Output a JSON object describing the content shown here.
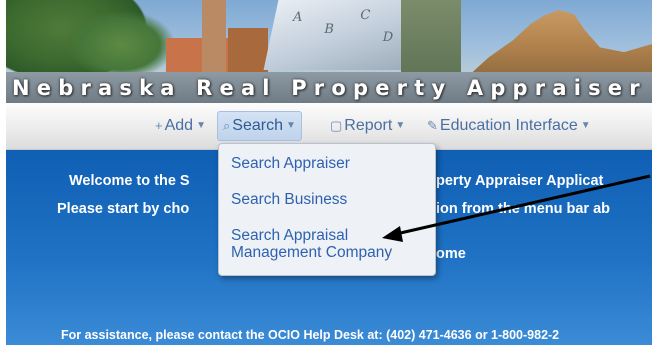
{
  "banner": {
    "title": "Nebraska Real Property Appraiser B",
    "plat_marks": [
      "A",
      "B",
      "C",
      "D"
    ]
  },
  "menu": {
    "items": [
      {
        "icon": "plus-icon",
        "glyph": "+",
        "label": "Add"
      },
      {
        "icon": "search-icon",
        "glyph": "⌕",
        "label": "Search",
        "active": true
      },
      {
        "icon": "report-icon",
        "glyph": "▢",
        "label": "Report"
      },
      {
        "icon": "pencil-icon",
        "glyph": "✎",
        "label": "Education Interface"
      }
    ]
  },
  "search_dropdown": {
    "items": [
      "Search Appraiser",
      "Search Business",
      "Search Appraisal Management Company"
    ]
  },
  "main": {
    "welcome": "Welcome to the S",
    "welcome_right": "perty Appraiser Applicat",
    "instruction": "Please start by cho",
    "instruction_right": "ion from the menu bar ab",
    "home_fragment": "ome",
    "footer": "For assistance, please contact the OCIO Help Desk at: (402) 471-4636 or 1-800-982-2"
  },
  "colors": {
    "main_bg": "#1565b8",
    "menu_text": "#4a6fa2",
    "dropdown_link": "#2e62b0",
    "arrow": "#000000"
  }
}
